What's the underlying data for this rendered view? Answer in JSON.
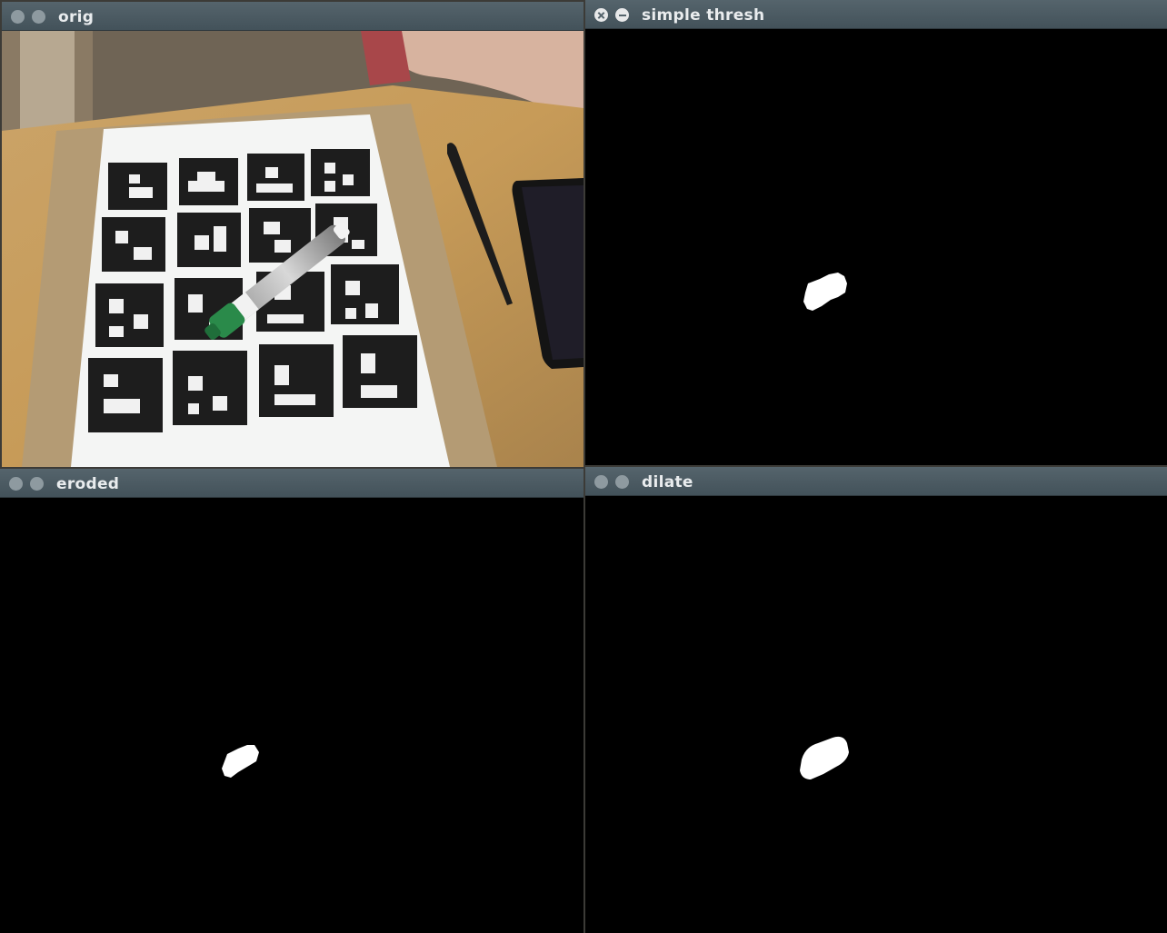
{
  "windows": {
    "orig": {
      "title": "orig"
    },
    "thresh": {
      "title": "simple thresh"
    },
    "eroded": {
      "title": "eroded"
    },
    "dilate": {
      "title": "dilate"
    }
  },
  "colors": {
    "titlebar": "#4b5a62",
    "mask_background": "#000000",
    "mask_blob": "#ffffff",
    "desk_wood": "#c49a5a",
    "marker_green": "#2a8a4a"
  }
}
